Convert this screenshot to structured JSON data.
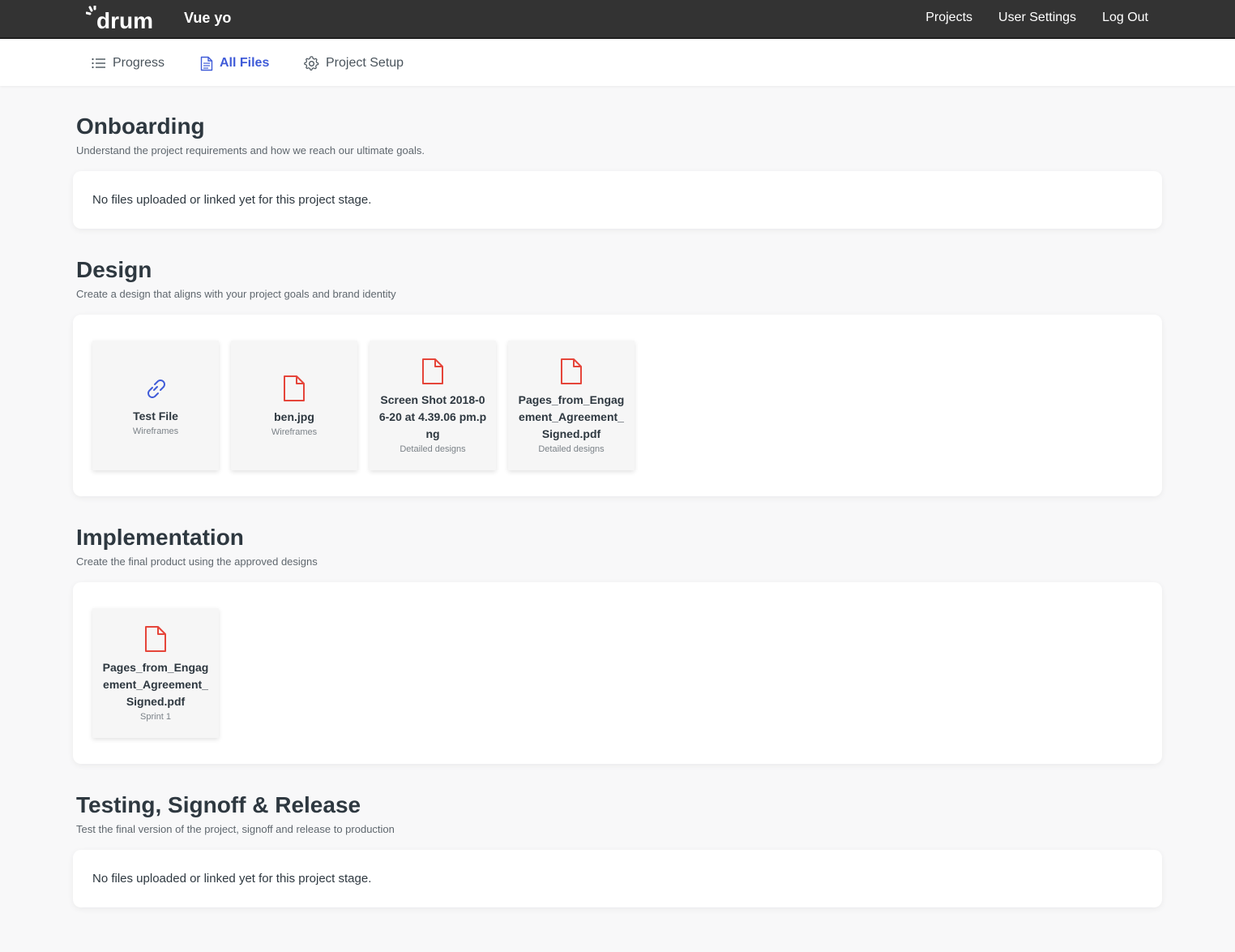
{
  "app": {
    "logo_text": "drum",
    "project_name": "Vue yo"
  },
  "topnav": [
    {
      "label": "Projects"
    },
    {
      "label": "User Settings"
    },
    {
      "label": "Log Out"
    }
  ],
  "subnav": {
    "progress": "Progress",
    "all_files": "All Files",
    "project_setup": "Project Setup",
    "active": "All Files"
  },
  "colors": {
    "topbar": "#333333",
    "accent": "#3f5bd8",
    "file_icon": "#e5453a",
    "link_icon": "#3f5bd8"
  },
  "sections": [
    {
      "title": "Onboarding",
      "description": "Understand the project requirements and how we reach our ultimate goals.",
      "empty_message": "No files uploaded or linked yet for this project stage."
    },
    {
      "title": "Design",
      "description": "Create a design that aligns with your project goals and brand identity",
      "files": [
        {
          "name": "Test File",
          "category": "Wireframes",
          "icon": "link-icon"
        },
        {
          "name": "ben.jpg",
          "category": "Wireframes",
          "icon": "file-icon"
        },
        {
          "name": "Screen Shot 2018-06-20 at 4.39.06 pm.png",
          "category": "Detailed designs",
          "icon": "file-icon"
        },
        {
          "name": "Pages_from_Engagement_Agreement_Signed.pdf",
          "category": "Detailed designs",
          "icon": "file-icon"
        }
      ]
    },
    {
      "title": "Implementation",
      "description": "Create the final product using the approved designs",
      "files": [
        {
          "name": "Pages_from_Engagement_Agreement_Signed.pdf",
          "category": "Sprint 1",
          "icon": "file-icon"
        }
      ]
    },
    {
      "title": "Testing, Signoff & Release",
      "description": "Test the final version of the project, signoff and release to production",
      "empty_message": "No files uploaded or linked yet for this project stage."
    }
  ]
}
